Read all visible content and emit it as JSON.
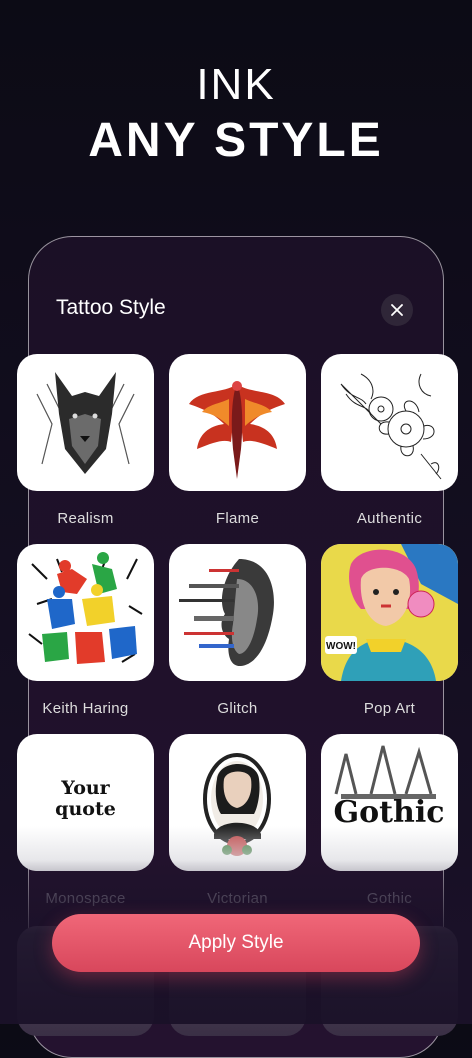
{
  "hero": {
    "line1": "INK",
    "line2": "ANY STYLE"
  },
  "panel": {
    "title": "Tattoo Style"
  },
  "styles": [
    {
      "label": "Realism"
    },
    {
      "label": "Flame"
    },
    {
      "label": "Authentic"
    },
    {
      "label": "Keith Haring"
    },
    {
      "label": "Glitch"
    },
    {
      "label": "Pop Art"
    },
    {
      "label": "Monospace",
      "thumb_text": "Your quote"
    },
    {
      "label": "Victorian"
    },
    {
      "label": "Gothic",
      "thumb_text": "Gothic"
    }
  ],
  "popart_bubble": "WOW!",
  "apply_button": {
    "label": "Apply Style"
  },
  "colors": {
    "accent": "#e8566a",
    "background": "#0c0b15",
    "panel": "#1f1129"
  }
}
